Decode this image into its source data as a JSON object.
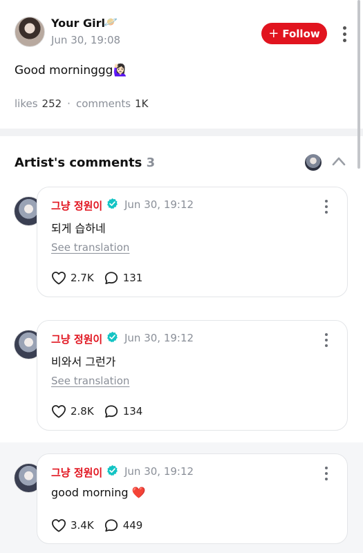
{
  "post": {
    "author": "Your Girl",
    "author_badge": "🪐",
    "time": "Jun 30, 19:08",
    "follow_label": "Follow",
    "text": "Good morninggg🙋🏻‍♀️",
    "likes_label": "likes",
    "likes_count": "252",
    "separator": "·",
    "comments_label": "comments",
    "comments_count": "1K"
  },
  "artist_comments": {
    "title": "Artist's comments",
    "count": "3",
    "items": [
      {
        "name": "그냥 정원이",
        "time": "Jun 30, 19:12",
        "text": "되게 습하네",
        "translate": "See translation",
        "likes": "2.7K",
        "replies": "131"
      },
      {
        "name": "그냥 정원이",
        "time": "Jun 30, 19:12",
        "text": "비와서 그런가",
        "translate": "See translation",
        "likes": "2.8K",
        "replies": "134"
      },
      {
        "name": "그냥 정원이",
        "time": "Jun 30, 19:12",
        "text": "good morning ❤️",
        "likes": "3.4K",
        "replies": "449"
      }
    ]
  },
  "colors": {
    "accent_red": "#e1141f",
    "verified_teal": "#14c4c4",
    "muted_gray": "#8a8f98",
    "band_gray": "#f1f2f4"
  },
  "icons": [
    "planet-icon",
    "plus-icon",
    "more-vertical-icon",
    "chevron-up-icon",
    "verified-icon",
    "heart-icon",
    "comment-bubble-icon"
  ]
}
